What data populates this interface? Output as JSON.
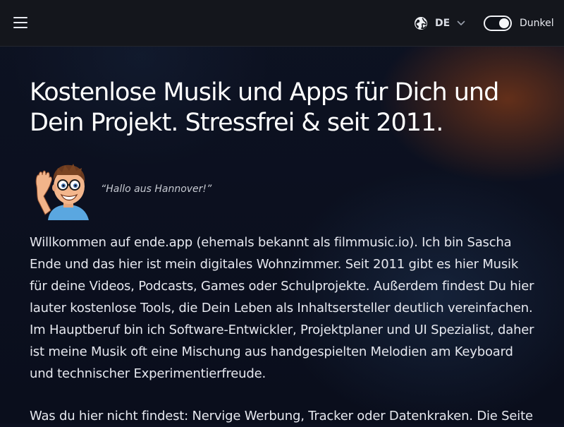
{
  "header": {
    "language_code": "DE",
    "theme_label": "Dunkel",
    "theme_dark_enabled": true
  },
  "hero": {
    "headline": "Kostenlose Musik und Apps für Dich und Dein Projekt. Stressfrei & seit 2011.",
    "greeting": "“Hallo aus Hannover!”"
  },
  "content": {
    "paragraph1": "Willkommen auf ende.app (ehemals bekannt als filmmusic.io). Ich bin Sascha Ende und das hier ist mein digitales Wohnzimmer. Seit 2011 gibt es hier Musik für deine Videos, Podcasts, Games oder Schulprojekte. Außerdem findest Du hier lauter kostenlose Tools, die Dein Leben als Inhaltsersteller deutlich vereinfachen. Im Hauptberuf bin ich Software-Entwickler, Projektplaner und UI Spezialist, daher ist meine Musik oft eine Mischung aus handgespielten Melodien am Keyboard und technischer Experimentierfreude.",
    "paragraph2": "Was du hier nicht findest: Nervige Werbung, Tracker oder Datenkraken. Die Seite"
  },
  "icons": {
    "menu": "hamburger-menu-icon",
    "language": "globe-icon",
    "language_dropdown": "chevron-down-icon"
  }
}
